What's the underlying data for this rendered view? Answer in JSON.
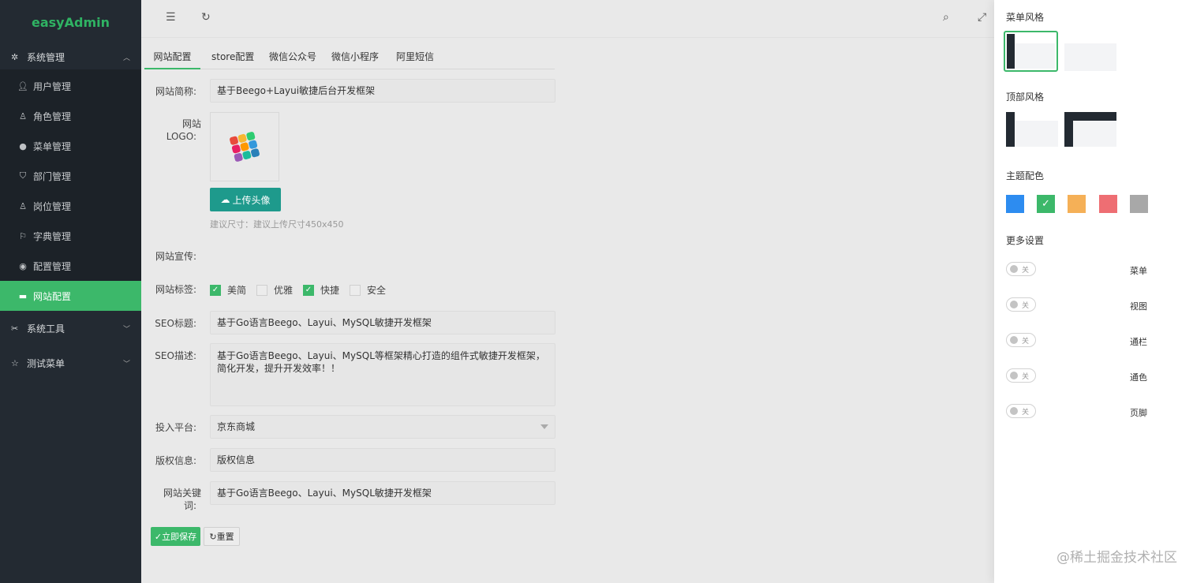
{
  "sidebar": {
    "logo": "easyAdmin",
    "group_system": "系统管理",
    "items": [
      {
        "label": "用户管理",
        "icon": "user-icon"
      },
      {
        "label": "角色管理",
        "icon": "role-icon"
      },
      {
        "label": "菜单管理",
        "icon": "menu-dot-icon"
      },
      {
        "label": "部门管理",
        "icon": "shield-icon"
      },
      {
        "label": "岗位管理",
        "icon": "post-icon"
      },
      {
        "label": "字典管理",
        "icon": "flag-icon"
      },
      {
        "label": "配置管理",
        "icon": "config-icon"
      },
      {
        "label": "网站配置",
        "icon": "site-icon",
        "active": true
      }
    ],
    "group_tools": "系统工具",
    "group_test": "测试菜单"
  },
  "tabs": [
    "网站配置",
    "store配置",
    "微信公众号",
    "微信小程序",
    "阿里短信"
  ],
  "form": {
    "site_name_label": "网站简称:",
    "site_name_value": "基于Beego+Layui敏捷后台开发框架",
    "logo_label_1": "网站",
    "logo_label_2": "LOGO:",
    "upload_label": "上传头像",
    "hint": "建议尺寸：建议上传尺寸450x450",
    "promo_label": "网站宣传:",
    "tags_label": "网站标签:",
    "tags": [
      {
        "label": "美简",
        "checked": true
      },
      {
        "label": "优雅",
        "checked": false
      },
      {
        "label": "快捷",
        "checked": true
      },
      {
        "label": "安全",
        "checked": false
      }
    ],
    "seo_title_label": "SEO标题:",
    "seo_title_value": "基于Go语言Beego、Layui、MySQL敏捷开发框架",
    "seo_desc_label": "SEO描述:",
    "seo_desc_value": "基于Go语言Beego、Layui、MySQL等框架精心打造的组件式敏捷开发框架，简化开发，提升开发效率！！",
    "platform_label": "投入平台:",
    "platform_value": "京东商城",
    "copyright_label": "版权信息:",
    "copyright_value": "版权信息",
    "keywords_label_1": "网站关键",
    "keywords_label_2": "词:",
    "keywords_value": "基于Go语言Beego、Layui、MySQL敏捷开发框架",
    "save_label": "立即保存",
    "reset_label": "重置"
  },
  "panel": {
    "menu_style": "菜单风格",
    "top_style": "顶部风格",
    "theme_color": "主题配色",
    "more": "更多设置",
    "colors": [
      "#2d8cf0",
      "#3cb86a",
      "#f5b057",
      "#ee6e73",
      "#a8a8a8"
    ],
    "selected_color_index": 1,
    "toggle_off": "关",
    "toggles": [
      "菜单",
      "视图",
      "通栏",
      "通色",
      "页脚"
    ]
  },
  "watermark": "@稀土掘金技术社区"
}
